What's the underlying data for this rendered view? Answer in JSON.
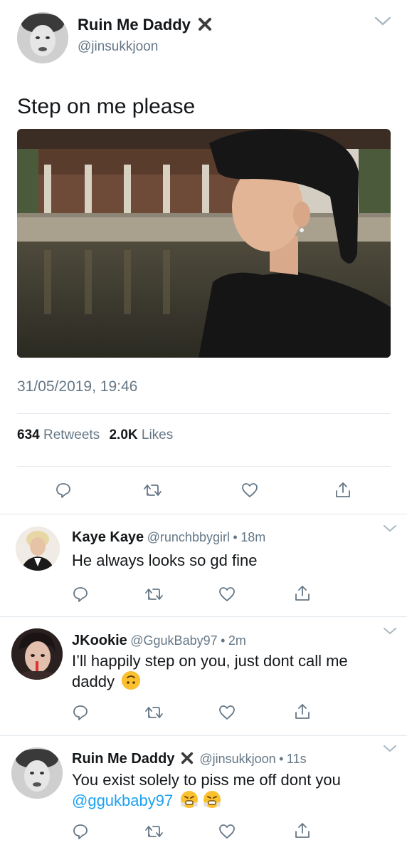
{
  "tweet": {
    "display_name": "Ruin Me Daddy",
    "handle": "@jinsukkjoon",
    "text": "Step on me please",
    "timestamp": "31/05/2019, 19:46",
    "retweets_count": "634",
    "retweets_label": "Retweets",
    "likes_count": "2.0K",
    "likes_label": "Likes"
  },
  "replies": [
    {
      "display_name": "Kaye Kaye",
      "handle": "@runchbbygirl",
      "dot": "•",
      "time": "18m",
      "text": "He always looks so gd fine"
    },
    {
      "display_name": "JKookie",
      "handle": "@GgukBaby97",
      "dot": "•",
      "time": "2m",
      "text_line1": "I’ll happily step on you, just dont call me",
      "text_line2": "daddy",
      "emoji": "upside-down-face"
    },
    {
      "display_name": "Ruin Me Daddy",
      "handle": "@jinsukkjoon",
      "dot": "•",
      "time": "11s",
      "text_line1": "You exist solely to piss me off dont you",
      "mention": "@ggukbaby97",
      "emoji": "face-with-steam-from-nose"
    }
  ],
  "icons": {
    "reply": "reply-icon",
    "retweet": "retweet-icon",
    "like": "heart-icon",
    "share": "share-icon",
    "more": "chevron-down-icon"
  },
  "colors": {
    "text": "#14171a",
    "secondary": "#657786",
    "link": "#1da1f2",
    "divider": "#e1e8ed"
  }
}
